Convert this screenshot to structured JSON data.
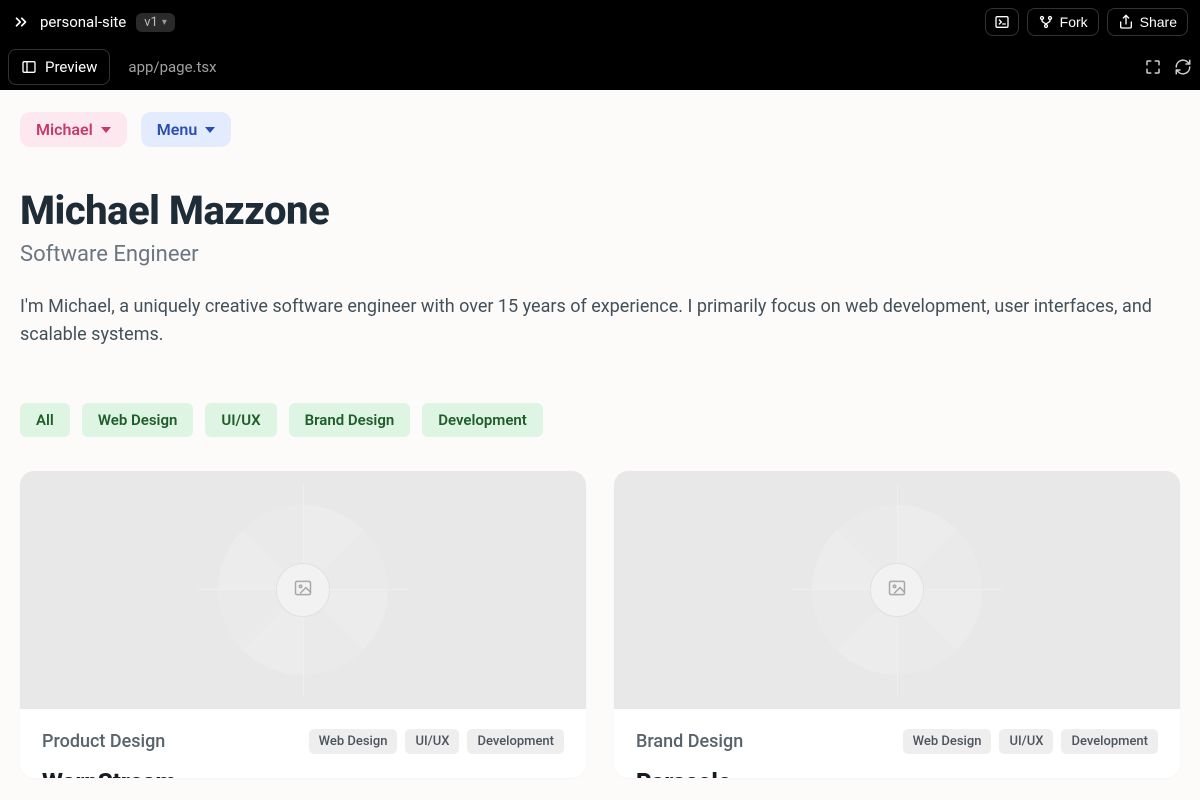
{
  "topbar": {
    "project_name": "personal-site",
    "version": "v1",
    "fork_label": "Fork",
    "share_label": "Share"
  },
  "tabs": {
    "preview_label": "Preview",
    "file_label": "app/page.tsx"
  },
  "pills": {
    "michael": "Michael",
    "menu": "Menu"
  },
  "hero": {
    "title": "Michael Mazzone",
    "subtitle": "Software Engineer",
    "bio": "I'm Michael, a uniquely creative software engineer with over 15 years of experience. I primarily focus on web development, user interfaces, and scalable systems."
  },
  "filters": [
    "All",
    "Web Design",
    "UI/UX",
    "Brand Design",
    "Development"
  ],
  "cards": [
    {
      "category": "Product Design",
      "tags": [
        "Web Design",
        "UI/UX",
        "Development"
      ],
      "title": "WarpStream"
    },
    {
      "category": "Brand Design",
      "tags": [
        "Web Design",
        "UI/UX",
        "Development"
      ],
      "title": "Parasole"
    }
  ]
}
